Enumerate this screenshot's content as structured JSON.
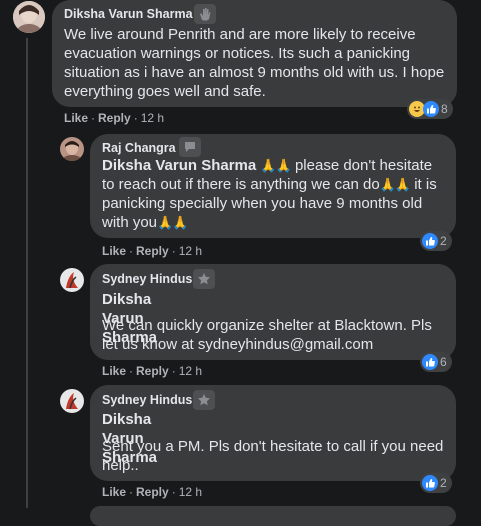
{
  "comments": [
    {
      "author": "Diksha Varun Sharma",
      "text": "We live around Penrith and are more likely to receive evacuation warnings or notices. Its such a panicking situation as i have an almost 9 months old with us. I hope everything goes well and safe.",
      "actions": {
        "like": "Like",
        "reply": "Reply",
        "time": "12 h"
      },
      "reaction_count": "8",
      "badge_icon": "wave-icon"
    },
    {
      "author": "Raj Changra",
      "mention": "Diksha Varun Sharma",
      "emoji": "🙏🙏",
      "text_1": "please don't hesitate to reach out if there is anything we can do",
      "text_2": "it is panicking specially when you have 9 months old with you",
      "actions": {
        "like": "Like",
        "reply": "Reply",
        "time": "12 h"
      },
      "reaction_count": "2",
      "badge_icon": "chat-bubble-icon"
    },
    {
      "author": "Sydney Hindus",
      "mention": "Diksha Varun Sharma",
      "text": "We can quickly organize shelter at Blacktown. Pls let us know at sydneyhindus@gmail.com",
      "actions": {
        "like": "Like",
        "reply": "Reply",
        "time": "12 h"
      },
      "reaction_count": "6",
      "badge_icon": "star-icon"
    },
    {
      "author": "Sydney Hindus",
      "mention": "Diksha Varun Sharma",
      "text": "Sent you a PM. Pls don't hesitate to call if you need help..",
      "actions": {
        "like": "Like",
        "reply": "Reply",
        "time": "12 h"
      },
      "reaction_count": "2",
      "badge_icon": "star-icon"
    }
  ],
  "colors": {
    "background": "#18191a",
    "bubble": "#3a3b3c",
    "like_blue": "#2e89ff",
    "muted_text": "#b0b3b8"
  }
}
